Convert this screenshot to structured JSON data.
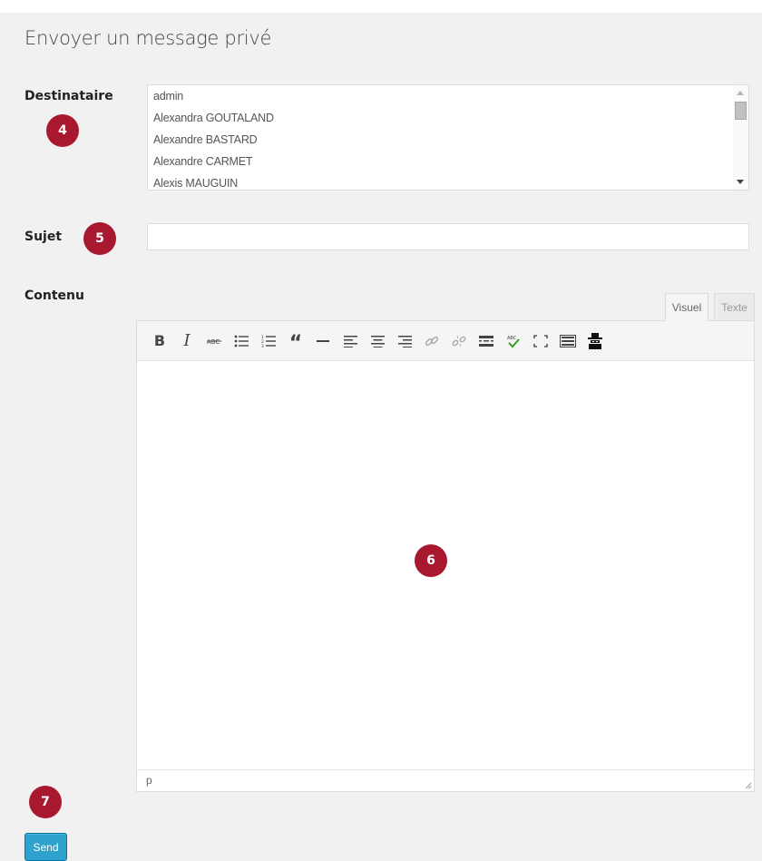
{
  "page": {
    "title": "Envoyer un message privé"
  },
  "fields": {
    "recipient_label": "Destinataire",
    "subject_label": "Sujet",
    "content_label": "Contenu",
    "subject_value": ""
  },
  "recipients": [
    "admin",
    "Alexandra GOUTALAND",
    "Alexandre BASTARD",
    "Alexandre CARMET",
    "Alexis MAUGUIN"
  ],
  "editor": {
    "tabs": {
      "visual": "Visuel",
      "text": "Texte"
    },
    "toolbar": [
      "bold",
      "italic",
      "strikethrough",
      "bullet-list",
      "numbered-list",
      "blockquote",
      "horizontal-rule",
      "align-left",
      "align-center",
      "align-right",
      "insert-link",
      "remove-link",
      "read-more",
      "spellcheck",
      "fullscreen",
      "toolbar-toggle",
      "spy"
    ],
    "status_path": "p"
  },
  "badges": {
    "b4": "4",
    "b5": "5",
    "b6": "6",
    "b7": "7"
  },
  "buttons": {
    "send": "Send"
  },
  "colors": {
    "badge": "#a8182e",
    "primary_button": "#2ea2cc",
    "panel_bg": "#f1f1f1"
  }
}
